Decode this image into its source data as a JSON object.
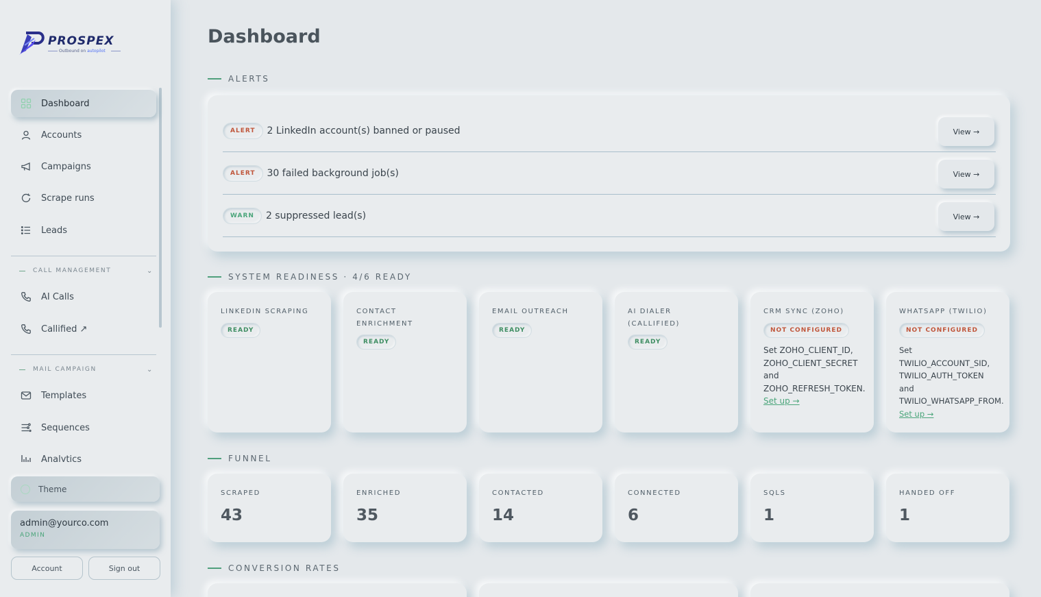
{
  "brand": {
    "name": "PROSPEX",
    "tagline_prefix": "Outbound on ",
    "tagline_highlight": "autopilot"
  },
  "sidebar": {
    "items": [
      {
        "label": "Dashboard",
        "icon": "grid-icon",
        "active": true
      },
      {
        "label": "Accounts",
        "icon": "user-icon"
      },
      {
        "label": "Campaigns",
        "icon": "megaphone-icon"
      },
      {
        "label": "Scrape runs",
        "icon": "refresh-icon"
      },
      {
        "label": "Leads",
        "icon": "list-icon"
      }
    ],
    "call_section": "CALL MANAGEMENT",
    "call_items": [
      {
        "label": "AI Calls",
        "icon": "phone-icon"
      },
      {
        "label": "Callified ↗",
        "icon": "phone-icon"
      }
    ],
    "mail_section": "MAIL CAMPAIGN",
    "mail_items": [
      {
        "label": "Templates",
        "icon": "mail-icon"
      },
      {
        "label": "Sequences",
        "icon": "sliders-icon"
      },
      {
        "label": "Analytics",
        "icon": "bar-chart-icon"
      }
    ],
    "theme_label": "Theme",
    "user_email": "admin@yourco.com",
    "user_role": "ADMIN",
    "account_button": "Account",
    "signout_button": "Sign out"
  },
  "main": {
    "title": "Dashboard",
    "alerts_title": "ALERTS",
    "alerts": [
      {
        "badge": "ALERT",
        "kind": "alert",
        "text": "2 LinkedIn account(s) banned or paused",
        "action": "View →"
      },
      {
        "badge": "ALERT",
        "kind": "alert",
        "text": "30 failed background job(s)",
        "action": "View →"
      },
      {
        "badge": "WARN",
        "kind": "warn",
        "text": "2 suppressed lead(s)",
        "action": "View →"
      }
    ],
    "readiness_title": "SYSTEM READINESS · 4/6 READY",
    "readiness": [
      {
        "label": "LINKEDIN SCRAPING",
        "status": "READY",
        "kind": "ready"
      },
      {
        "label": "CONTACT ENRICHMENT",
        "status": "READY",
        "kind": "ready"
      },
      {
        "label": "EMAIL OUTREACH",
        "status": "READY",
        "kind": "ready"
      },
      {
        "label": "AI DIALER (CALLIFIED)",
        "status": "READY",
        "kind": "ready"
      },
      {
        "label": "CRM SYNC (ZOHO)",
        "status": "NOT CONFIGURED",
        "kind": "notcfg",
        "desc_lines": [
          "Set ZOHO_CLIENT_ID,",
          "ZOHO_CLIENT_SECRET",
          "and",
          "ZOHO_REFRESH_TOKEN."
        ],
        "link": "Set up →"
      },
      {
        "label": "WHATSAPP (TWILIO)",
        "status": "NOT CONFIGURED",
        "kind": "notcfg",
        "desc_lines": [
          "Set",
          "TWILIO_ACCOUNT_SID,",
          "TWILIO_AUTH_TOKEN",
          "and",
          "TWILIO_WHATSAPP_FROM."
        ],
        "link": "Set up →"
      }
    ],
    "funnel_title": "FUNNEL",
    "funnel": [
      {
        "label": "SCRAPED",
        "value": "43"
      },
      {
        "label": "ENRICHED",
        "value": "35"
      },
      {
        "label": "CONTACTED",
        "value": "14"
      },
      {
        "label": "CONNECTED",
        "value": "6"
      },
      {
        "label": "SQLS",
        "value": "1"
      },
      {
        "label": "HANDED OFF",
        "value": "1"
      }
    ],
    "conversion_title": "CONVERSION RATES"
  }
}
